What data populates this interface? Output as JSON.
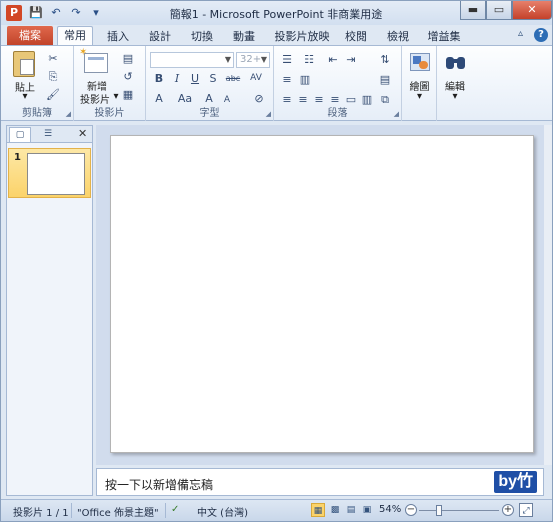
{
  "window": {
    "title": "簡報1 - Microsoft PowerPoint 非商業用途",
    "app_icon": "P",
    "qat": {
      "save_icon": "💾",
      "undo_icon": "↶",
      "redo_icon": "↷",
      "customize_icon": "▾"
    },
    "controls": {
      "minimize": "▬",
      "maximize": "▭",
      "close": "✕"
    }
  },
  "tabs": {
    "file": "檔案",
    "items": [
      "常用",
      "插入",
      "設計",
      "切換",
      "動畫",
      "投影片放映",
      "校閱",
      "檢視",
      "增益集"
    ],
    "active_index": 0,
    "minimize_icon": "▵",
    "help_icon": "?"
  },
  "ribbon": {
    "clipboard": {
      "label": "剪貼簿",
      "paste": "貼上",
      "paste_arrow": "▾",
      "cut_icon": "✂",
      "copy_icon": "⎘",
      "painter_icon": "🖌"
    },
    "slides": {
      "label": "投影片",
      "new_slide_line1": "新增",
      "new_slide_line2": "投影片",
      "new_slide_arrow": "▾",
      "layout_icon": "▤",
      "reset_icon": "↺",
      "section_icon": "▦"
    },
    "font": {
      "label": "字型",
      "font_name": "",
      "font_size": "32+",
      "grow": "A",
      "shrink": "A",
      "clear": "⊘",
      "bold": "B",
      "italic": "I",
      "underline": "U",
      "strike": "S",
      "strike2": "abc",
      "spacing": "AV",
      "case": "Aa",
      "color": "A"
    },
    "paragraph": {
      "label": "段落"
    },
    "drawing": {
      "label": "繪圖",
      "arrow": "▾"
    },
    "editing": {
      "label": "編輯",
      "arrow": "▾"
    }
  },
  "panel": {
    "slide_number": "1",
    "close_icon": "✕"
  },
  "notes": {
    "placeholder": "按一下以新增備忘稿",
    "watermark": "by竹"
  },
  "status": {
    "slide_info": "投影片 1 / 1",
    "theme": "\"Office 佈景主題\"",
    "language": "中文 (台灣)",
    "zoom": "54%",
    "zoom_minus": "−",
    "zoom_plus": "+",
    "zoom_percent": 54
  },
  "colors": {
    "accent": "#d24726",
    "ribbon_border": "#a6b9d4",
    "selected": "#fbd36a"
  }
}
